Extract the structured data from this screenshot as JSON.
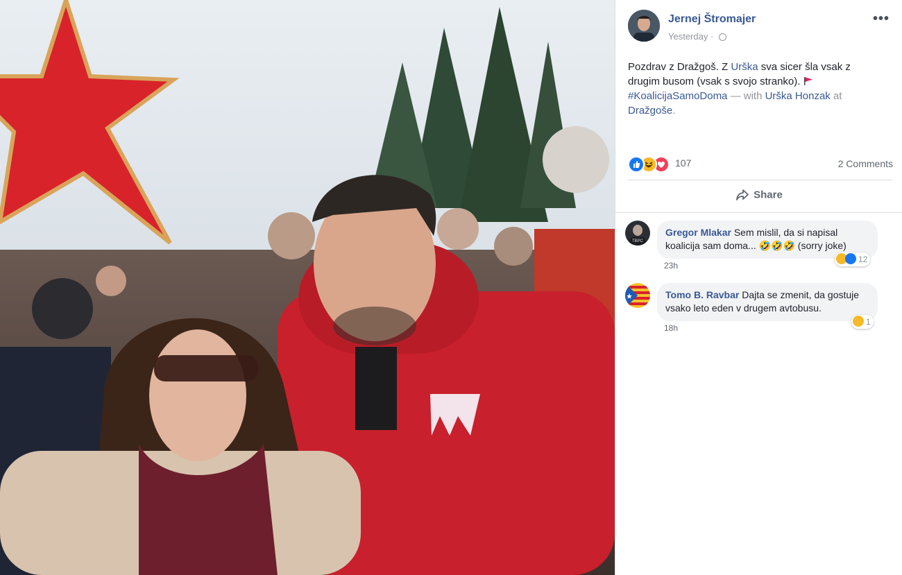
{
  "post": {
    "author": "Jernej Štromajer",
    "timestamp": "Yesterday",
    "privacy_icon": "globe-icon",
    "text_1": "Pozdrav z Dražgoš. Z ",
    "mention_1": "Urška",
    "text_2": " sva sicer šla vsak z drugim busom (vsak s svojo stranko). ",
    "hashtag": "#KoalicijaSamoDoma",
    "with_text": " — with ",
    "tagged": "Urška Honzak",
    "at_text": " at",
    "location": "Dražgoše",
    "end": "."
  },
  "stats": {
    "reactions_count": "107",
    "reaction_icons": [
      "like-icon",
      "haha-icon",
      "love-icon"
    ],
    "comments_count": "2 Comments"
  },
  "actions": {
    "share_label": "Share"
  },
  "comments": [
    {
      "name": "Gregor Mlakar",
      "text": "Sem mislil, da si napisal koalicija sam doma... 🤣🤣🤣 (sorry joke)",
      "time": "23h",
      "reaction_count": "12"
    },
    {
      "name": "Tomo B. Ravbar",
      "text": "Dajta se zmenit, da gostuje vsako leto eden v drugem avtobusu.",
      "time": "18h",
      "reaction_count": "1"
    }
  ],
  "colors": {
    "link": "#385898",
    "like": "#1877f2",
    "haha": "#f7b928",
    "love": "#f33e58"
  }
}
